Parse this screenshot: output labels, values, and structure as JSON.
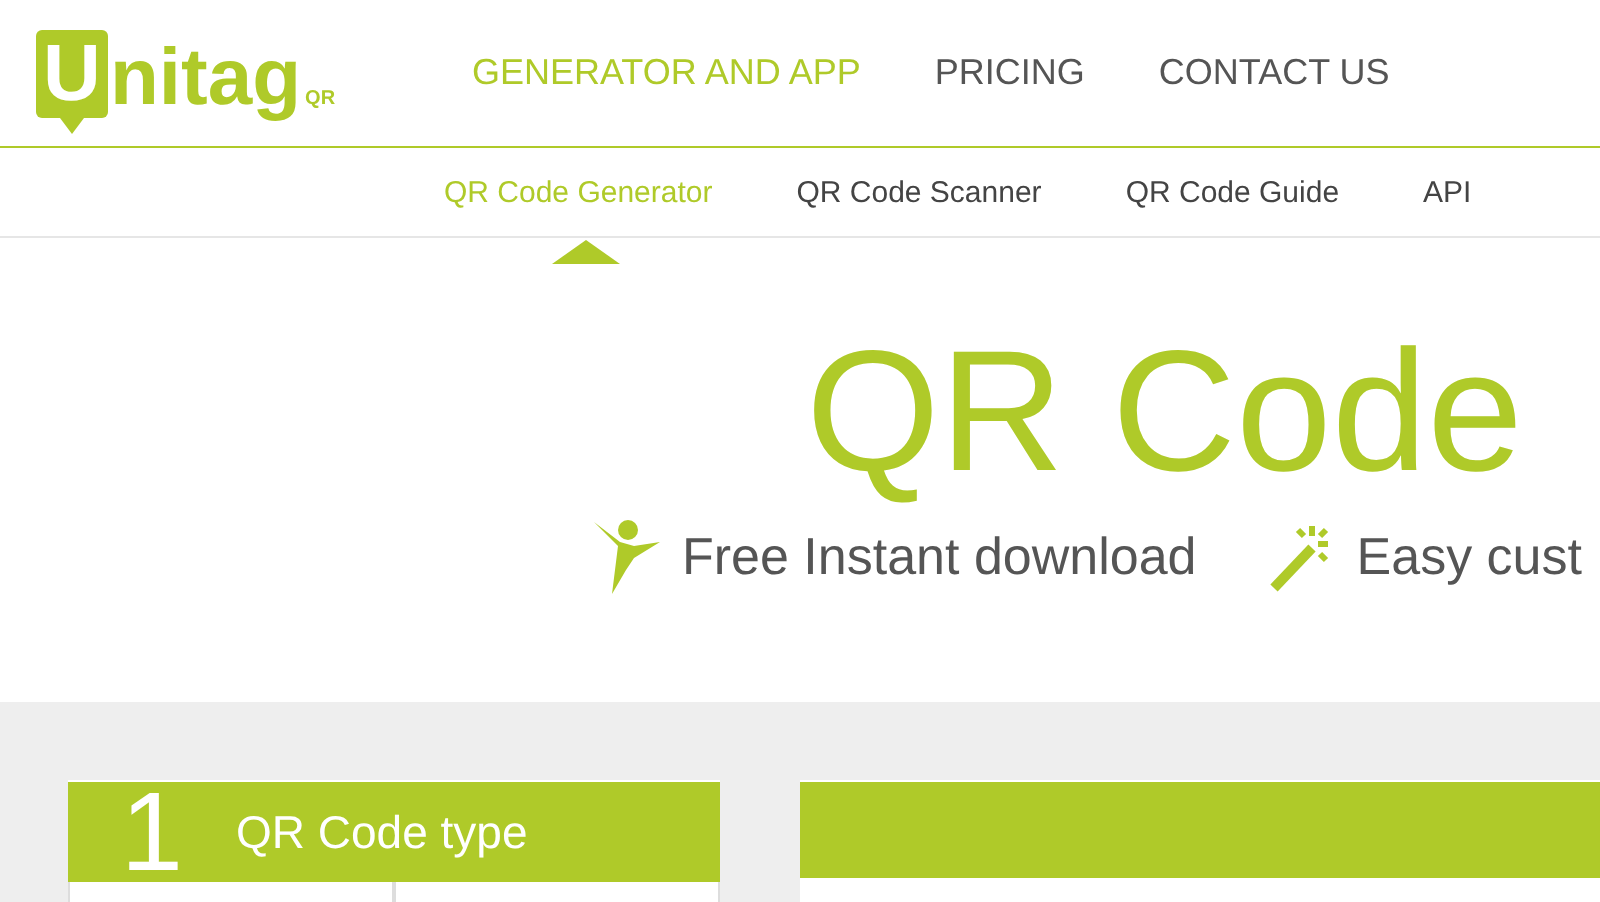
{
  "logo": {
    "initial": "U",
    "rest": "nitag",
    "suffix": "QR"
  },
  "nav": [
    {
      "label": "GENERATOR AND APP",
      "selected": true
    },
    {
      "label": "PRICING",
      "selected": false
    },
    {
      "label": "CONTACT US",
      "selected": false
    }
  ],
  "subnav": [
    {
      "label": "QR Code Generator",
      "selected": true
    },
    {
      "label": "QR Code Scanner",
      "selected": false
    },
    {
      "label": "QR Code Guide",
      "selected": false
    },
    {
      "label": "API",
      "selected": false
    }
  ],
  "hero": {
    "title": "QR Code",
    "features": [
      {
        "kind": "person",
        "label": "Free Instant download"
      },
      {
        "kind": "wand",
        "label": "Easy cust"
      }
    ]
  },
  "step": {
    "number": "1",
    "title": "QR Code type"
  }
}
